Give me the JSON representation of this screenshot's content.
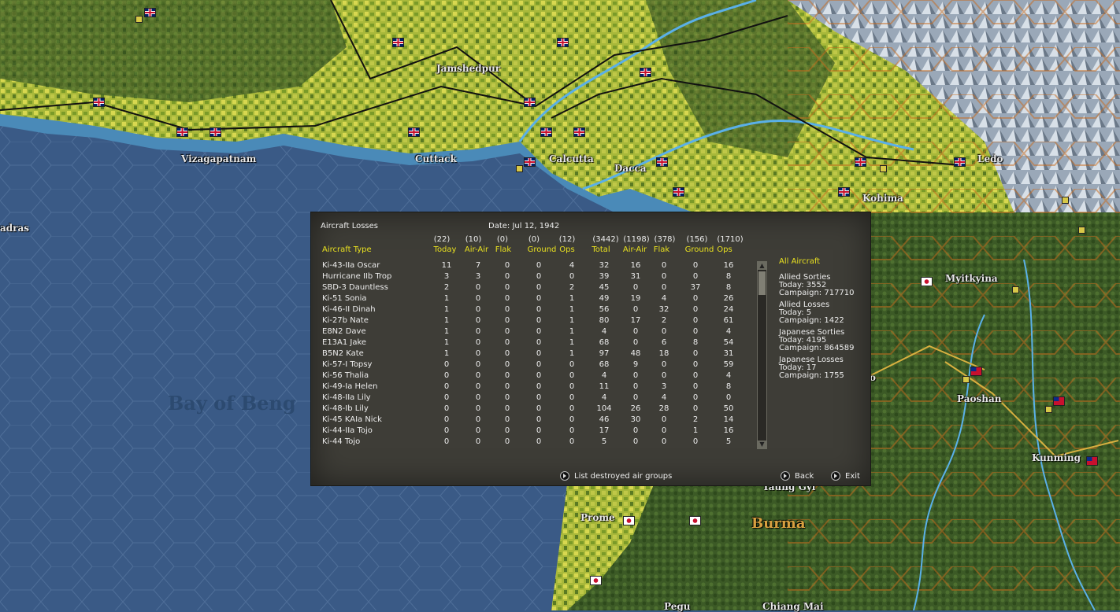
{
  "map": {
    "labels": [
      {
        "text": "Jamshedpur"
      },
      {
        "text": "Vizagapatnam"
      },
      {
        "text": "Cuttack"
      },
      {
        "text": "Calcutta"
      },
      {
        "text": "Dacca"
      },
      {
        "text": "Kohima"
      },
      {
        "text": "Ledo"
      },
      {
        "text": "Myitkyina"
      },
      {
        "text": "Paoshan"
      },
      {
        "text": "Kunming"
      },
      {
        "text": "Prome"
      },
      {
        "text": "Burma"
      },
      {
        "text": "Pegu"
      },
      {
        "text": "Chiang Mai"
      },
      {
        "text": "Taung Gyi"
      },
      {
        "text": "adras"
      },
      {
        "text": "Bay of Beng"
      },
      {
        "text": "o"
      }
    ]
  },
  "panel": {
    "title": "Aircraft Losses",
    "date": "Date: Jul 12, 1942",
    "column_totals": [
      "(22)",
      "(10)",
      "(0)",
      "(0)",
      "(12)",
      "(3442)",
      "(1198)",
      "(378)",
      "(156)",
      "(1710)"
    ],
    "column_headers": [
      "Aircraft Type",
      "Today",
      "Air-Air",
      "Flak",
      "Ground",
      "Ops",
      "Total",
      "Air-Air",
      "Flak",
      "Ground",
      "Ops"
    ],
    "rows": [
      {
        "name": "Ki-43-IIa Oscar",
        "v": [
          "11",
          "7",
          "0",
          "0",
          "4",
          "32",
          "16",
          "0",
          "0",
          "16"
        ]
      },
      {
        "name": "Hurricane IIb Trop",
        "v": [
          "3",
          "3",
          "0",
          "0",
          "0",
          "39",
          "31",
          "0",
          "0",
          "8"
        ]
      },
      {
        "name": "SBD-3 Dauntless",
        "v": [
          "2",
          "0",
          "0",
          "0",
          "2",
          "45",
          "0",
          "0",
          "37",
          "8"
        ]
      },
      {
        "name": "Ki-51 Sonia",
        "v": [
          "1",
          "0",
          "0",
          "0",
          "1",
          "49",
          "19",
          "4",
          "0",
          "26"
        ]
      },
      {
        "name": "Ki-46-II Dinah",
        "v": [
          "1",
          "0",
          "0",
          "0",
          "1",
          "56",
          "0",
          "32",
          "0",
          "24"
        ]
      },
      {
        "name": "Ki-27b Nate",
        "v": [
          "1",
          "0",
          "0",
          "0",
          "1",
          "80",
          "17",
          "2",
          "0",
          "61"
        ]
      },
      {
        "name": "E8N2 Dave",
        "v": [
          "1",
          "0",
          "0",
          "0",
          "1",
          "4",
          "0",
          "0",
          "0",
          "4"
        ]
      },
      {
        "name": "E13A1 Jake",
        "v": [
          "1",
          "0",
          "0",
          "0",
          "1",
          "68",
          "0",
          "6",
          "8",
          "54"
        ]
      },
      {
        "name": "B5N2 Kate",
        "v": [
          "1",
          "0",
          "0",
          "0",
          "1",
          "97",
          "48",
          "18",
          "0",
          "31"
        ]
      },
      {
        "name": "Ki-57-I Topsy",
        "v": [
          "0",
          "0",
          "0",
          "0",
          "0",
          "68",
          "9",
          "0",
          "0",
          "59"
        ]
      },
      {
        "name": "Ki-56 Thalia",
        "v": [
          "0",
          "0",
          "0",
          "0",
          "0",
          "4",
          "0",
          "0",
          "0",
          "4"
        ]
      },
      {
        "name": "Ki-49-Ia Helen",
        "v": [
          "0",
          "0",
          "0",
          "0",
          "0",
          "11",
          "0",
          "3",
          "0",
          "8"
        ]
      },
      {
        "name": "Ki-48-IIa Lily",
        "v": [
          "0",
          "0",
          "0",
          "0",
          "0",
          "4",
          "0",
          "4",
          "0",
          "0"
        ]
      },
      {
        "name": "Ki-48-Ib Lily",
        "v": [
          "0",
          "0",
          "0",
          "0",
          "0",
          "104",
          "26",
          "28",
          "0",
          "50"
        ]
      },
      {
        "name": "Ki-45 KAIa Nick",
        "v": [
          "0",
          "0",
          "0",
          "0",
          "0",
          "46",
          "30",
          "0",
          "2",
          "14"
        ]
      },
      {
        "name": "Ki-44-IIa Tojo",
        "v": [
          "0",
          "0",
          "0",
          "0",
          "0",
          "17",
          "0",
          "0",
          "1",
          "16"
        ]
      },
      {
        "name": "Ki-44 Tojo",
        "v": [
          "0",
          "0",
          "0",
          "0",
          "0",
          "5",
          "0",
          "0",
          "0",
          "5"
        ]
      }
    ],
    "filter_label": "All Aircraft",
    "stats": [
      {
        "title": "Allied Sorties",
        "today": "Today:   3552",
        "campaign": "Campaign: 717710"
      },
      {
        "title": "Allied Losses",
        "today": "Today:  5",
        "campaign": "Campaign: 1422"
      },
      {
        "title": "Japanese Sorties",
        "today": "Today:   4195",
        "campaign": "Campaign: 864589"
      },
      {
        "title": "Japanese Losses",
        "today": "Today:  17",
        "campaign": "Campaign: 1755"
      }
    ],
    "buttons": {
      "list_destroyed": "List destroyed air groups",
      "back": "Back",
      "exit": "Exit"
    }
  }
}
